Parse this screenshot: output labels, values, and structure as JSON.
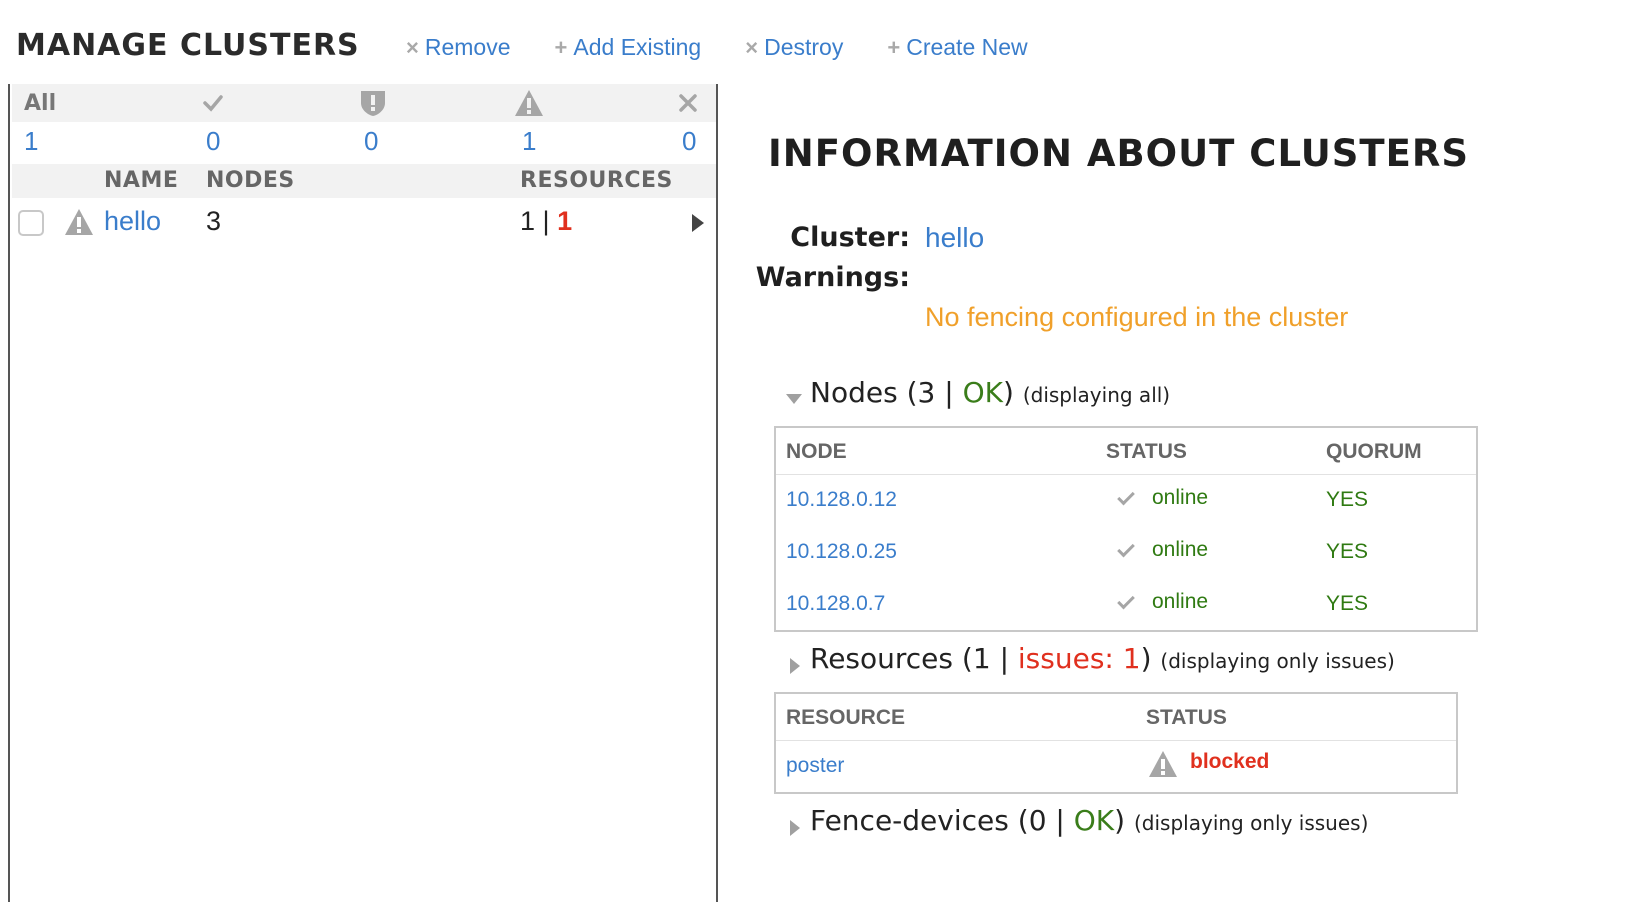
{
  "header": {
    "title": "MANAGE CLUSTERS",
    "actions": [
      {
        "icon": "×",
        "label": "Remove"
      },
      {
        "icon": "+",
        "label": "Add Existing"
      },
      {
        "icon": "×",
        "label": "Destroy"
      },
      {
        "icon": "+",
        "label": "Create New"
      }
    ]
  },
  "filters": {
    "all_label": "All",
    "icons": [
      "check-icon",
      "shield-alert-icon",
      "warning-icon",
      "close-icon"
    ],
    "counts": [
      "1",
      "0",
      "0",
      "1",
      "0"
    ]
  },
  "cluster_table": {
    "headers": {
      "name": "NAME",
      "nodes": "NODES",
      "resources": "RESOURCES"
    },
    "rows": [
      {
        "status_icon": "warning-icon",
        "name": "hello",
        "nodes": "3",
        "resources_total": "1",
        "separator": "|",
        "resources_issues": "1"
      }
    ]
  },
  "info": {
    "title": "INFORMATION ABOUT CLUSTERS",
    "cluster_label": "Cluster:",
    "cluster_name": "hello",
    "warnings_label": "Warnings:",
    "warning_message": "No fencing configured in the cluster",
    "nodes_section": {
      "label": "Nodes",
      "open": "(",
      "count": "3",
      "sep": " | ",
      "status": "OK",
      "close": ")",
      "note": "(displaying all)",
      "headers": {
        "node": "NODE",
        "status": "STATUS",
        "quorum": "QUORUM"
      },
      "rows": [
        {
          "node": "10.128.0.12",
          "status": "online",
          "quorum": "YES"
        },
        {
          "node": "10.128.0.25",
          "status": "online",
          "quorum": "YES"
        },
        {
          "node": "10.128.0.7",
          "status": "online",
          "quorum": "YES"
        }
      ]
    },
    "resources_section": {
      "label": "Resources",
      "open": "(",
      "count": "1",
      "sep": " | ",
      "issues": "issues: 1",
      "close": ")",
      "note": "(displaying only issues)",
      "headers": {
        "resource": "RESOURCE",
        "status": "STATUS"
      },
      "rows": [
        {
          "resource": "poster",
          "status_icon": "warning-icon",
          "status": "blocked"
        }
      ]
    },
    "fence_section": {
      "label": "Fence-devices",
      "open": "(",
      "count": "0",
      "sep": " | ",
      "status": "OK",
      "close": ")",
      "note": "(displaying only issues)"
    }
  },
  "colors": {
    "link": "#3a7dcb",
    "ok_green": "#2f7a12",
    "error_red": "#e0301e",
    "warning_orange": "#f0a02a",
    "icon_gray": "#a0a0a0"
  }
}
